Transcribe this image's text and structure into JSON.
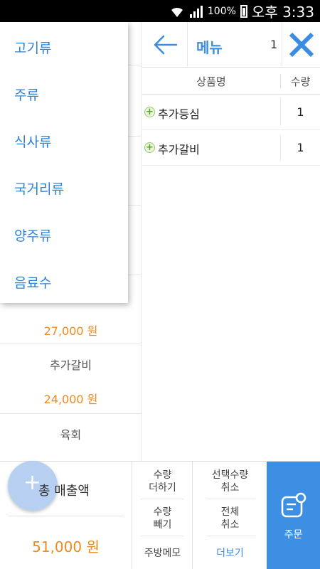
{
  "status_bar": {
    "battery": "100%",
    "time": "오후 3:33"
  },
  "header": {
    "title": "메뉴",
    "count": "1"
  },
  "columns": {
    "name": "상품명",
    "qty": "수량"
  },
  "order_items": [
    {
      "name": "추가등심",
      "qty": "1"
    },
    {
      "name": "추가갈비",
      "qty": "1"
    }
  ],
  "categories": [
    "고기류",
    "주류",
    "식사류",
    "국거리류",
    "양주류",
    "음료수"
  ],
  "products": [
    {
      "price": "27,000 원"
    },
    {
      "name": "추가갈비",
      "price": "24,000 원"
    },
    {
      "name": "육회"
    }
  ],
  "bottom": {
    "total_label": "총 매출액",
    "total_value": "51,000 원",
    "qty_add": "수량\n더하기",
    "qty_sub": "수량\n빼기",
    "kitchen_memo": "주방메모",
    "cancel_selected": "선택수량\n취소",
    "cancel_all": "전체\n취소",
    "more": "더보기",
    "order": "주문"
  },
  "colors": {
    "accent": "#3d8fe3",
    "price": "#f08a1c",
    "category": "#2f82d6"
  }
}
